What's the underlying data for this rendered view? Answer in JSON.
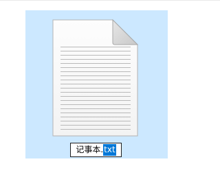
{
  "file": {
    "icon": "text-document-icon",
    "rename": {
      "name_part": "记事本.",
      "selected_extension": "txt"
    }
  },
  "colors": {
    "selection_background": "#cce8ff",
    "text_selection": "#0078d7",
    "rename_border": "#1e1e1e"
  }
}
